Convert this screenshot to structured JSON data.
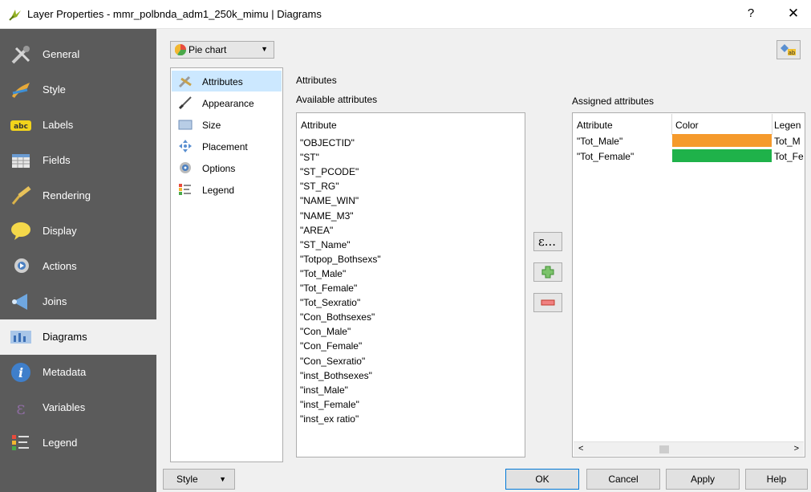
{
  "window": {
    "title": "Layer Properties - mmr_polbnda_adm1_250k_mimu | Diagrams",
    "help_label": "?",
    "close_label": "✕"
  },
  "sidebar": {
    "items": [
      {
        "label": "General",
        "icon": "general-icon"
      },
      {
        "label": "Style",
        "icon": "style-icon"
      },
      {
        "label": "Labels",
        "icon": "labels-icon"
      },
      {
        "label": "Fields",
        "icon": "fields-icon"
      },
      {
        "label": "Rendering",
        "icon": "rendering-icon"
      },
      {
        "label": "Display",
        "icon": "display-icon"
      },
      {
        "label": "Actions",
        "icon": "actions-icon"
      },
      {
        "label": "Joins",
        "icon": "joins-icon"
      },
      {
        "label": "Diagrams",
        "icon": "diagrams-icon",
        "active": true
      },
      {
        "label": "Metadata",
        "icon": "metadata-icon"
      },
      {
        "label": "Variables",
        "icon": "variables-icon"
      },
      {
        "label": "Legend",
        "icon": "legend-icon"
      }
    ]
  },
  "diagram_type": {
    "selected": "Pie chart"
  },
  "subnav": {
    "items": [
      {
        "label": "Attributes",
        "active": true
      },
      {
        "label": "Appearance"
      },
      {
        "label": "Size"
      },
      {
        "label": "Placement"
      },
      {
        "label": "Options"
      },
      {
        "label": "Legend"
      }
    ]
  },
  "attributes": {
    "section_title": "Attributes",
    "available_title": "Available attributes",
    "available_header": "Attribute",
    "available": [
      "\"OBJECTID\"",
      "\"ST\"",
      "\"ST_PCODE\"",
      "\"ST_RG\"",
      "\"NAME_WIN\"",
      "\"NAME_M3\"",
      "\"AREA\"",
      "\"ST_Name\"",
      "\"Totpop_Bothsexs\"",
      "\"Tot_Male\"",
      "\"Tot_Female\"",
      "\"Tot_Sexratio\"",
      "\"Con_Bothsexes\"",
      "\"Con_Male\"",
      "\"Con_Female\"",
      "\"Con_Sexratio\"",
      "\"inst_Bothsexes\"",
      "\"inst_Male\"",
      "\"inst_Female\"",
      "\"inst_ex ratio\""
    ],
    "expression_button": "ε...",
    "assigned_title": "Assigned attributes",
    "assigned_headers": {
      "attribute": "Attribute",
      "color": "Color",
      "legend": "Legen"
    },
    "assigned": [
      {
        "attribute": "\"Tot_Male\"",
        "color": "#f59a2c",
        "legend": "Tot_M"
      },
      {
        "attribute": "\"Tot_Female\"",
        "color": "#1fb24a",
        "legend": "Tot_Fe"
      }
    ]
  },
  "footer": {
    "style_label": "Style",
    "ok_label": "OK",
    "cancel_label": "Cancel",
    "apply_label": "Apply",
    "help_label": "Help"
  }
}
